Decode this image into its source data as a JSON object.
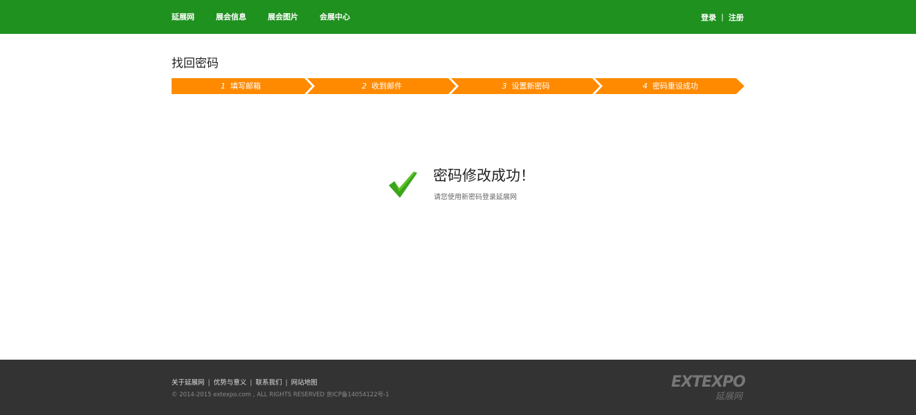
{
  "nav": {
    "items": [
      {
        "label": "延展网"
      },
      {
        "label": "展会信息"
      },
      {
        "label": "展会图片"
      },
      {
        "label": "会展中心"
      }
    ],
    "login": "登录",
    "separator": "|",
    "register": "注册"
  },
  "page": {
    "title": "找回密码"
  },
  "steps": [
    {
      "num": "1",
      "label": "填写邮箱"
    },
    {
      "num": "2",
      "label": "收到邮件"
    },
    {
      "num": "3",
      "label": "设置新密码"
    },
    {
      "num": "4",
      "label": "密码重设成功"
    }
  ],
  "result": {
    "title": "密码修改成功！",
    "subtitle": "请您使用新密码登录延展网",
    "icon": "check-icon"
  },
  "footer": {
    "links": [
      "关于延展网",
      "优势与意义",
      "联系我们",
      "网站地图"
    ],
    "separator": "|",
    "copyright": "© 2014-2015 extexpo.com , ALL RIGHTS RESERVED  京ICP备14054122号-1",
    "logo_en": "EXTEXPO",
    "logo_cn": "延展网"
  },
  "colors": {
    "header": "#1f911f",
    "step": "#ff8a00",
    "footer": "#333333",
    "check": "#3aa51a"
  }
}
